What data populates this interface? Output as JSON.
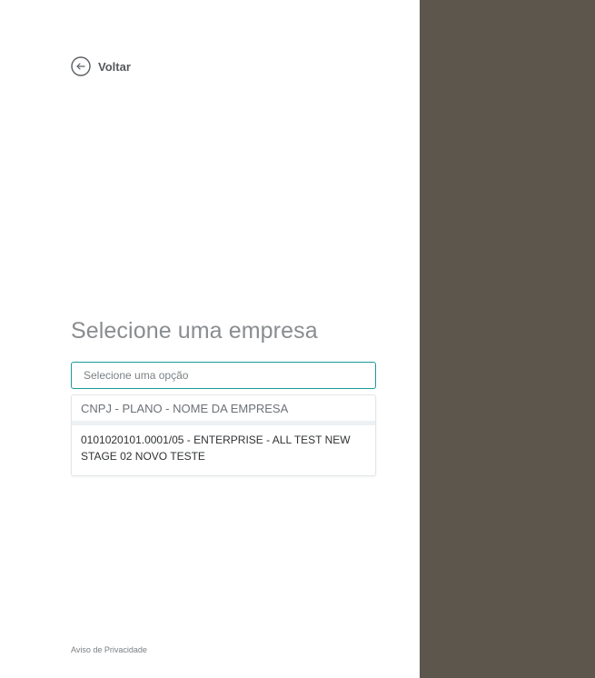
{
  "back": {
    "label": "Voltar",
    "icon": "arrow-left-circle-icon"
  },
  "main": {
    "title": "Selecione uma empresa",
    "select": {
      "placeholder": "Selecione uma opção",
      "value": ""
    },
    "dropdown": {
      "header": "CNPJ - PLANO - NOME DA EMPRESA",
      "options": [
        {
          "label": "0101020101.0001/05 - ENTERPRISE - ALL TEST NEW STAGE 02 NOVO TESTE"
        }
      ]
    }
  },
  "footer": {
    "privacy_label": "Aviso de Privacidade"
  },
  "colors": {
    "side_panel": "#5d564c",
    "input_focus_border": "#1c9a9a",
    "title_text": "#8a8d90"
  }
}
